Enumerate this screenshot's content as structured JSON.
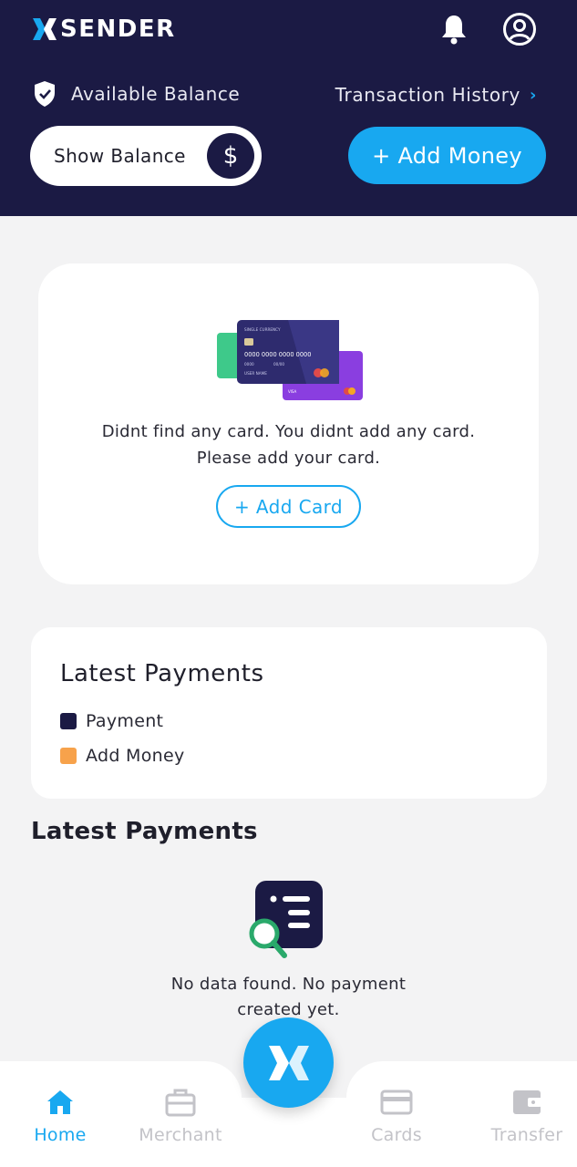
{
  "app": {
    "name": "SENDER"
  },
  "colors": {
    "brand_dark": "#1b1a44",
    "accent": "#18a8f0",
    "payment": "#1b1a44",
    "add_money": "#f7a24b",
    "nav_inactive": "#c3c3c8"
  },
  "header": {
    "available_label": "Available Balance",
    "history_label": "Transaction History",
    "history_chevron": "›",
    "show_balance_label": "Show Balance",
    "currency_symbol": "$",
    "add_money_label": "+ Add Money"
  },
  "cards": {
    "empty_line1": "Didnt find any card. You didnt add any card.",
    "empty_line2": "Please add your card.",
    "add_card_label": "+ Add Card",
    "illustration": {
      "front_caption": "SINGLE CURRENCY",
      "front_number": "0000 0000 0000 0000",
      "front_small": "0000",
      "front_exp": "00/00",
      "front_name": "USER NAME"
    }
  },
  "payments_chart": {
    "title": "Latest Payments",
    "legend": [
      {
        "label": "Payment",
        "color": "#1b1a44"
      },
      {
        "label": "Add Money",
        "color": "#f7a24b"
      }
    ]
  },
  "payments_list": {
    "title": "Latest Payments",
    "empty_line1": "No data found. No payment",
    "empty_line2": "created yet."
  },
  "nav": {
    "items": [
      {
        "label": "Home",
        "icon": "home-icon",
        "active": true
      },
      {
        "label": "Merchant",
        "icon": "briefcase-icon",
        "active": false
      },
      {
        "label": "Cards",
        "icon": "card-icon",
        "active": false
      },
      {
        "label": "Transfer",
        "icon": "wallet-icon",
        "active": false
      }
    ]
  }
}
